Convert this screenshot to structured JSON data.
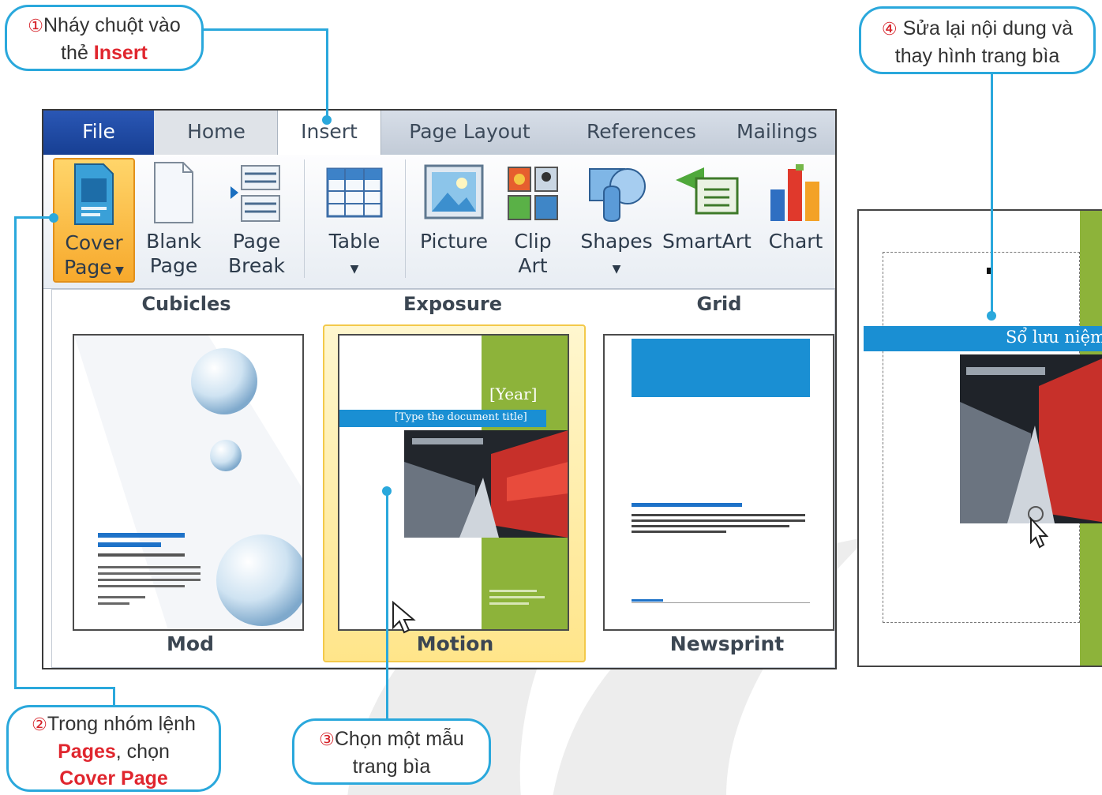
{
  "callouts": {
    "step1": {
      "num": "①",
      "line1": "Nháy chuột vào",
      "line2_prefix": "thẻ ",
      "line2_red": "Insert"
    },
    "step2": {
      "num": "②",
      "line1": "Trong nhóm lệnh",
      "line2_red": "Pages",
      "line2_suffix": ", chọn",
      "line3_red": "Cover Page"
    },
    "step3": {
      "num": "③",
      "line1": "Chọn một mẫu",
      "line2": "trang bìa"
    },
    "step4": {
      "num": "④",
      "line1": "Sửa lại nội dung và",
      "line2": "thay hình trang bìa"
    }
  },
  "tabs": [
    "File",
    "Home",
    "Insert",
    "Page Layout",
    "References",
    "Mailings"
  ],
  "ribbon": {
    "cover_page": {
      "line1": "Cover",
      "line2": "Page"
    },
    "blank_page": {
      "line1": "Blank",
      "line2": "Page"
    },
    "page_break": {
      "line1": "Page",
      "line2": "Break"
    },
    "table": "Table",
    "picture": "Picture",
    "clip_art": {
      "line1": "Clip",
      "line2": "Art"
    },
    "shapes": "Shapes",
    "smartart": "SmartArt",
    "chart": "Chart"
  },
  "gallery": {
    "top_labels": [
      "Cubicles",
      "Exposure",
      "Grid"
    ],
    "templates": [
      "Mod",
      "Motion",
      "Newsprint"
    ],
    "selected": "Motion"
  },
  "motion_thumb": {
    "year": "[Year]",
    "title": "[Type the document title]"
  },
  "doc_preview": {
    "title_band": "Sổ lưu niệm"
  },
  "colors": {
    "callout_border": "#2aa8dc",
    "highlight_red": "#e0262e",
    "motion_green": "#8db33a",
    "title_blue": "#1a8fd3",
    "file_tab": "#1f4aa3"
  }
}
